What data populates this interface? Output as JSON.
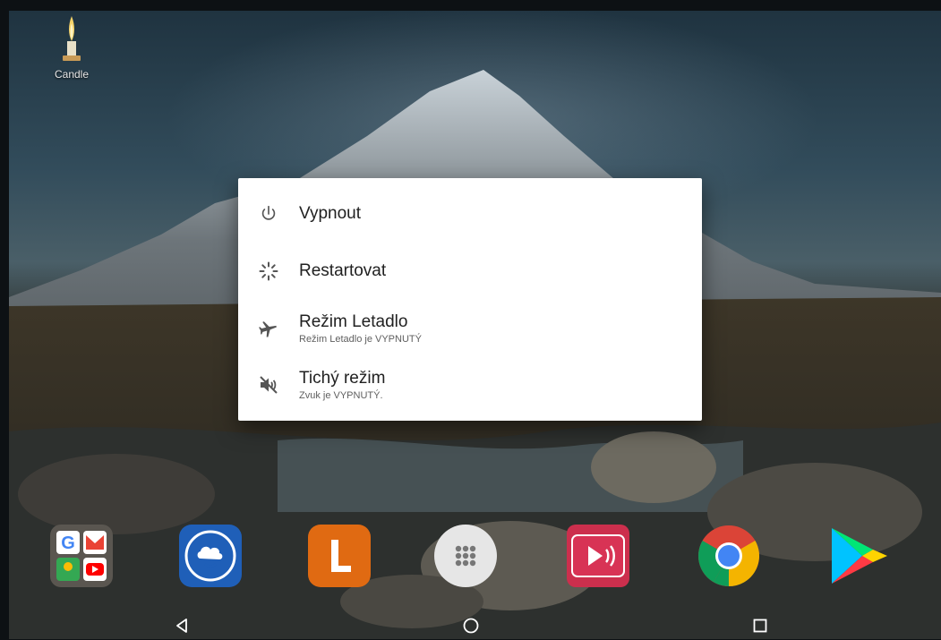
{
  "desktop": {
    "candle_label": "Candle",
    "candle_icon": "candle-icon"
  },
  "power_menu": {
    "items": [
      {
        "icon": "power-icon",
        "title": "Vypnout",
        "subtitle": ""
      },
      {
        "icon": "restart-icon",
        "title": "Restartovat",
        "subtitle": ""
      },
      {
        "icon": "airplane-icon",
        "title": "Režim Letadlo",
        "subtitle": "Režim Letadlo je VYPNUTÝ"
      },
      {
        "icon": "volume-off-icon",
        "title": "Tichý režim",
        "subtitle": "Zvuk je VYPNUTÝ."
      }
    ]
  },
  "dock": {
    "apps": [
      {
        "icon": "google-apps-folder-icon"
      },
      {
        "icon": "cloud-sync-icon"
      },
      {
        "icon": "launcher-l-icon"
      },
      {
        "icon": "app-drawer-icon"
      },
      {
        "icon": "media-player-icon"
      },
      {
        "icon": "chrome-icon"
      },
      {
        "icon": "play-store-icon"
      }
    ]
  },
  "navigation": {
    "back": "back-icon",
    "home": "home-icon",
    "recents": "recents-icon"
  }
}
